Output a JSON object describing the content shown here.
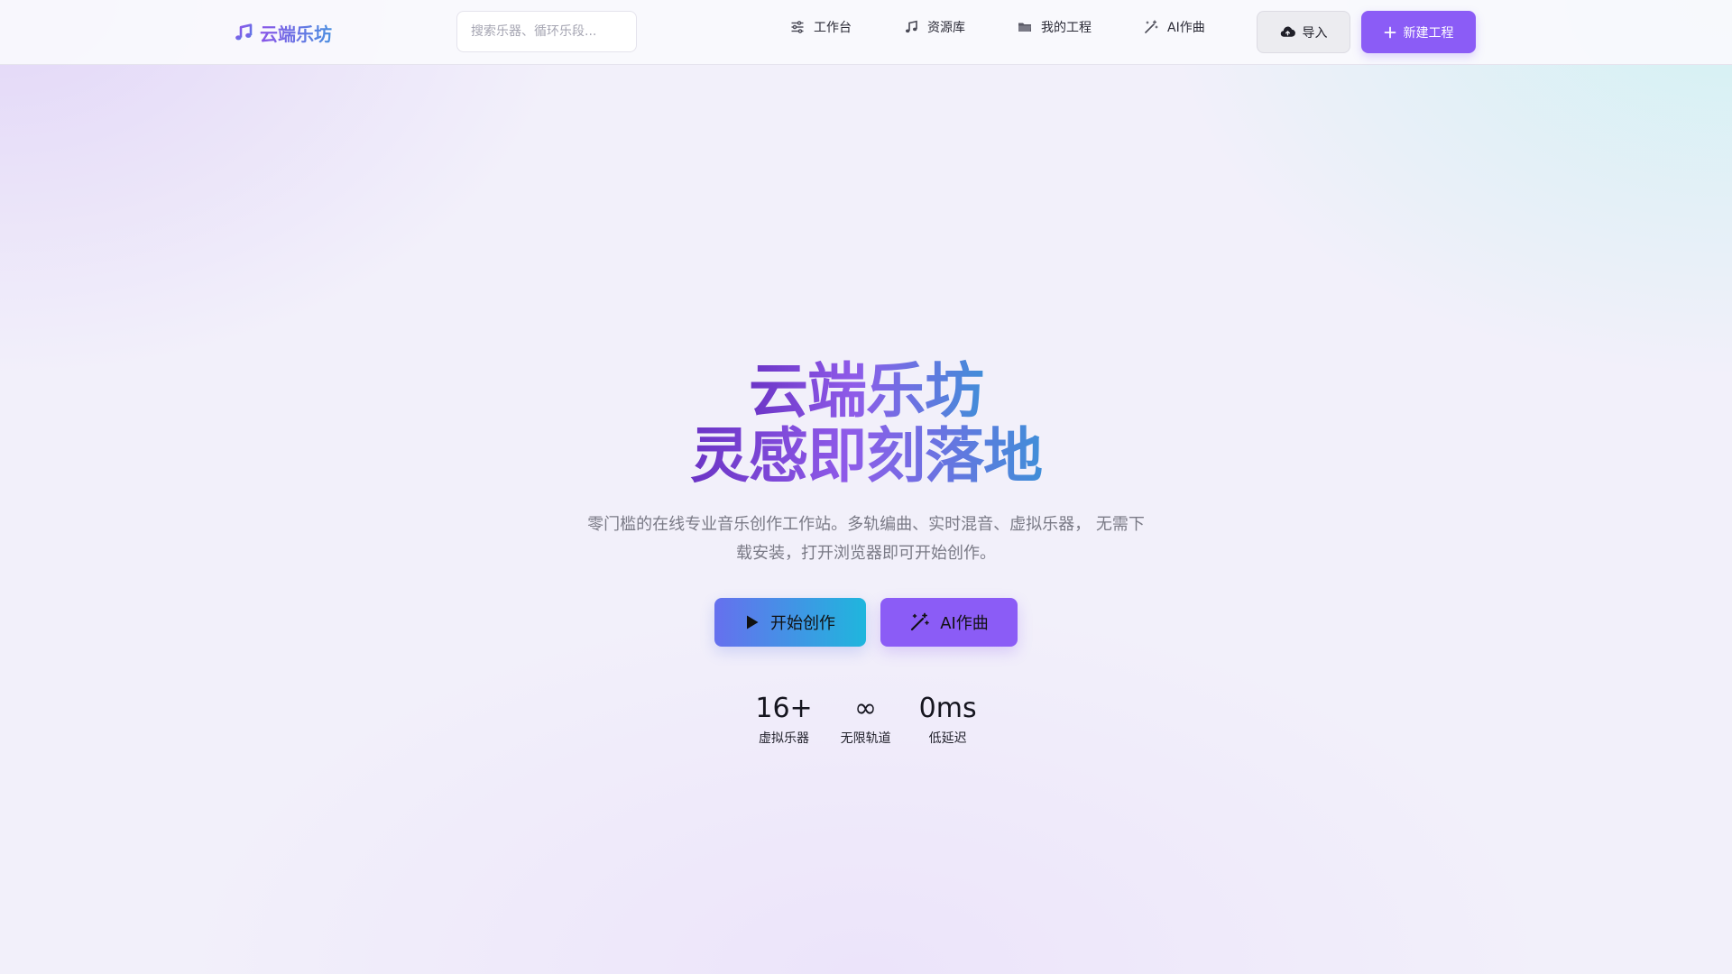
{
  "header": {
    "logo_text": "云端乐坊",
    "search_placeholder": "搜索乐器、循环乐段...",
    "nav": [
      {
        "label": "工作台",
        "icon": "sliders-icon"
      },
      {
        "label": "资源库",
        "icon": "music-note-icon"
      },
      {
        "label": "我的工程",
        "icon": "folder-icon"
      },
      {
        "label": "AI作曲",
        "icon": "magic-wand-icon"
      }
    ],
    "import_label": "导入",
    "new_project_label": "新建工程"
  },
  "hero": {
    "title_line1": "云端乐坊",
    "title_line2": "灵感即刻落地",
    "subtitle": "零门槛的在线专业音乐创作工作站。多轨编曲、实时混音、虚拟乐器， 无需下载安装，打开浏览器即可开始创作。",
    "start_label": "开始创作",
    "ai_label": "AI作曲"
  },
  "stats": [
    {
      "value": "16+",
      "label": "虚拟乐器"
    },
    {
      "value": "∞",
      "label": "无限轨道"
    },
    {
      "value": "0ms",
      "label": "低延迟"
    }
  ],
  "colors": {
    "accent": "#8b5cf6",
    "gradient_start": "#6670ee",
    "gradient_end": "#1fb6dd"
  }
}
